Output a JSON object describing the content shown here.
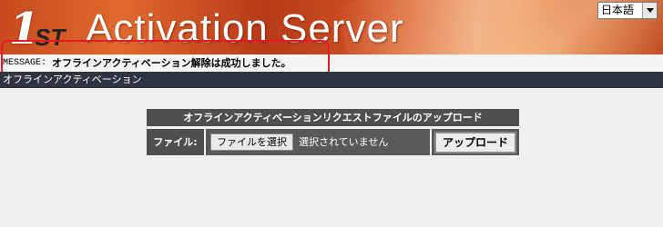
{
  "header": {
    "logo_number": "1",
    "logo_suffix": "ST",
    "title": "Activation Server"
  },
  "language": {
    "selected": "日本語"
  },
  "message": {
    "prefix": "MESSAGE:",
    "text": "オフラインアクティベーション解除は成功しました。",
    "highlight_color": "#e21a2a"
  },
  "section": {
    "title": "オフラインアクティベーション"
  },
  "upload_form": {
    "heading": "オフラインアクティベーションリクエストファイルのアップロード",
    "file_label": "ファイル:",
    "choose_file_button": "ファイルを選択",
    "file_status": "選択されていません",
    "upload_button": "アップロード"
  },
  "colors": {
    "banner": "#d2562a",
    "section_bar": "#2e3440",
    "form_header": "#4f4f4f"
  }
}
